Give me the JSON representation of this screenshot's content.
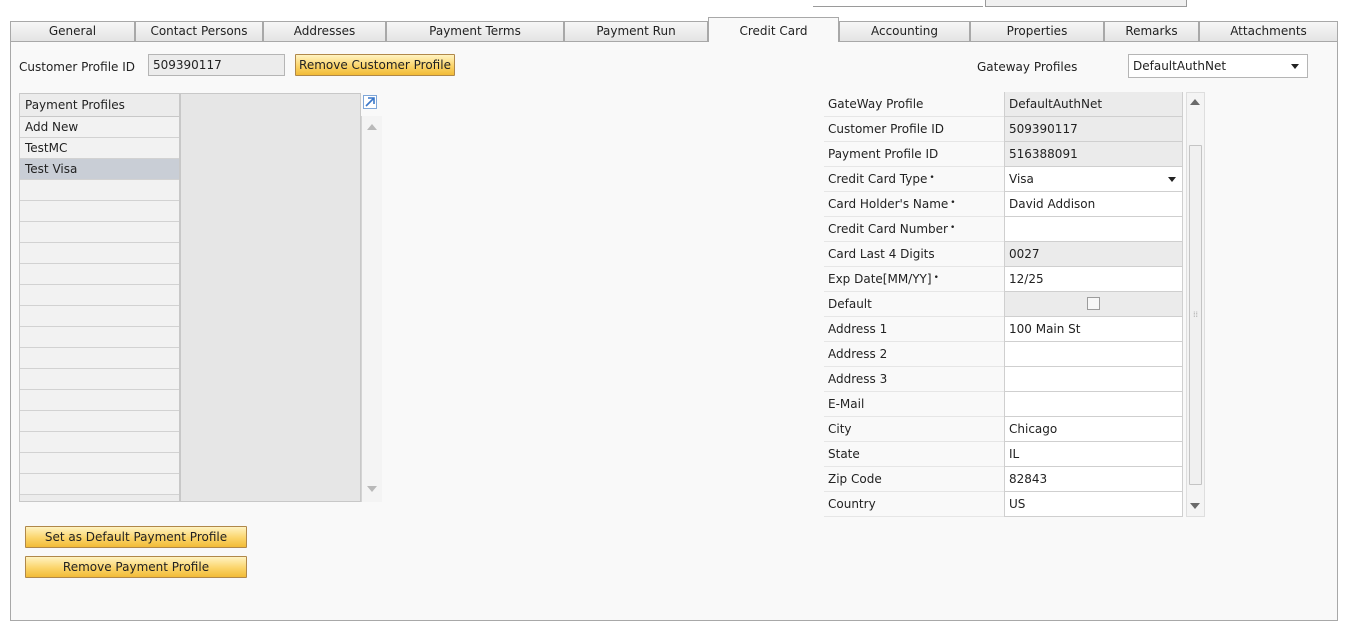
{
  "tabs": [
    {
      "label": "General",
      "active": false
    },
    {
      "label": "Contact Persons",
      "active": false
    },
    {
      "label": "Addresses",
      "active": false
    },
    {
      "label": "Payment Terms",
      "active": false
    },
    {
      "label": "Payment Run",
      "active": false
    },
    {
      "label": "Credit Card",
      "active": true
    },
    {
      "label": "Accounting",
      "active": false
    },
    {
      "label": "Properties",
      "active": false
    },
    {
      "label": "Remarks",
      "active": false
    },
    {
      "label": "Attachments",
      "active": false
    }
  ],
  "header": {
    "customer_profile_label": "Customer Profile ID",
    "customer_profile_value": "509390117",
    "remove_customer_profile": "Remove Customer Profile",
    "gateway_profiles_label": "Gateway Profiles",
    "gateway_profiles_value": "DefaultAuthNet"
  },
  "payment_profiles": {
    "header": "Payment Profiles",
    "items": [
      "Add New",
      "TestMC",
      "Test Visa"
    ],
    "selected_index": 2,
    "empty_rows": 16
  },
  "detail": {
    "rows": [
      {
        "label": "GateWay Profile",
        "value": "DefaultAuthNet",
        "required": false,
        "readonly": true
      },
      {
        "label": "Customer Profile ID",
        "value": "509390117",
        "required": false,
        "readonly": true
      },
      {
        "label": "Payment Profile ID",
        "value": "516388091",
        "required": false,
        "readonly": true
      },
      {
        "label": "Credit Card Type",
        "value": "Visa",
        "required": true,
        "readonly": false,
        "dropdown": true
      },
      {
        "label": "Card Holder's Name",
        "value": "David Addison",
        "required": true,
        "readonly": false
      },
      {
        "label": "Credit Card Number",
        "value": "",
        "required": true,
        "readonly": false
      },
      {
        "label": "Card Last 4 Digits",
        "value": "0027",
        "required": false,
        "readonly": true
      },
      {
        "label": "Exp Date[MM/YY]",
        "value": "12/25",
        "required": true,
        "readonly": false
      },
      {
        "label": "Default",
        "value": "",
        "required": false,
        "readonly": true,
        "checkbox": true
      },
      {
        "label": "Address 1",
        "value": "100 Main St",
        "required": false,
        "readonly": false
      },
      {
        "label": "Address 2",
        "value": "",
        "required": false,
        "readonly": false
      },
      {
        "label": "Address 3",
        "value": "",
        "required": false,
        "readonly": false
      },
      {
        "label": "E-Mail",
        "value": "",
        "required": false,
        "readonly": false
      },
      {
        "label": "City",
        "value": "Chicago",
        "required": false,
        "readonly": false
      },
      {
        "label": "State",
        "value": "IL",
        "required": false,
        "readonly": false
      },
      {
        "label": "Zip Code",
        "value": "82843",
        "required": false,
        "readonly": false
      },
      {
        "label": "Country",
        "value": "US",
        "required": false,
        "readonly": false
      }
    ],
    "required_marker": "•"
  },
  "buttons": {
    "set_default": "Set as Default Payment Profile",
    "remove_payment_profile": "Remove Payment Profile"
  },
  "icons": {
    "expand": "expand-arrow-icon",
    "dropdown": "chevron-down-icon",
    "scroll_up": "scroll-up-icon",
    "scroll_down": "scroll-down-icon"
  },
  "colors": {
    "button_gradient_top": "#fff3c2",
    "button_gradient_bottom": "#f2bb37",
    "selected_row": "#c9ced6",
    "expand_icon": "#3a77c8"
  }
}
